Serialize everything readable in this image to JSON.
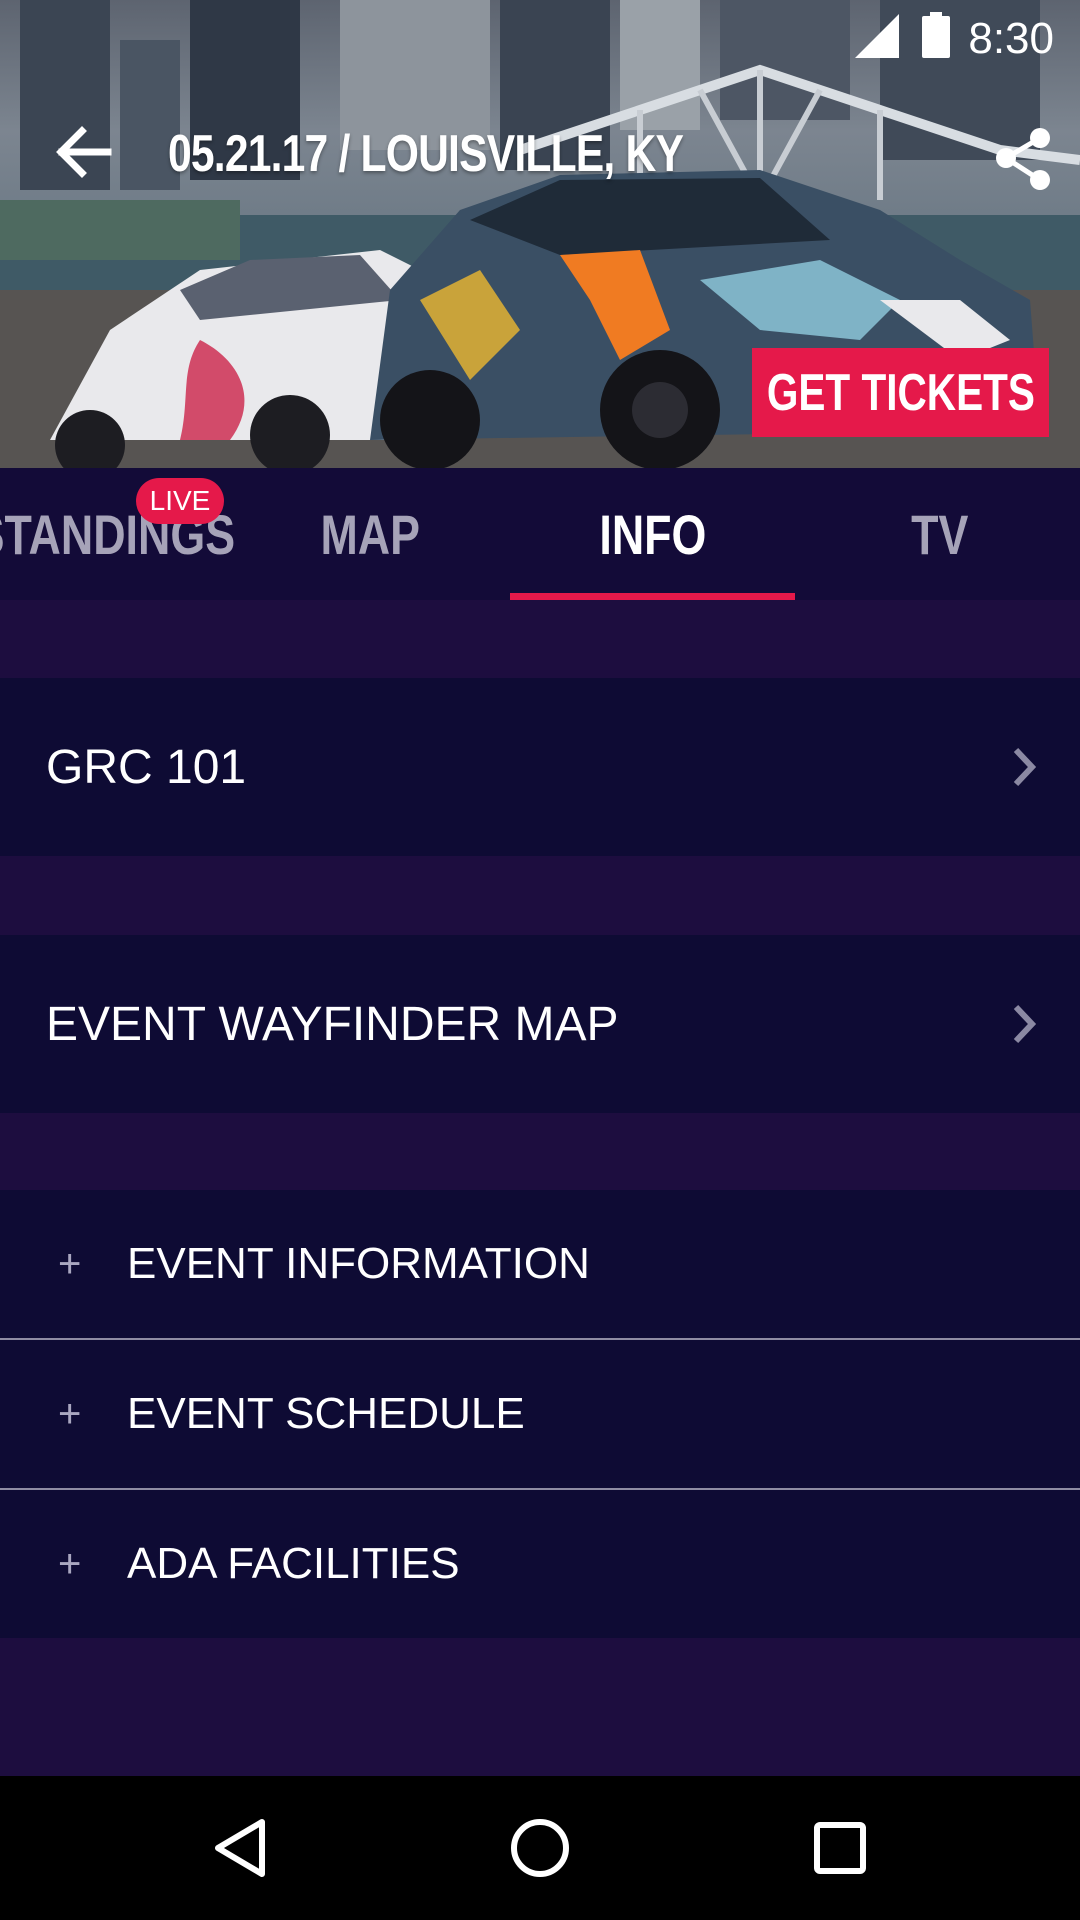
{
  "status_bar": {
    "time": "8:30"
  },
  "header": {
    "title": "05.21.17 / LOUISVILLE, KY",
    "tickets_label": "GET TICKETS"
  },
  "tabs": [
    {
      "label": "STANDINGS",
      "badge": "LIVE",
      "active": false
    },
    {
      "label": "MAP",
      "active": false
    },
    {
      "label": "INFO",
      "active": true
    },
    {
      "label": "TV",
      "active": false
    }
  ],
  "links": [
    {
      "label": "GRC 101"
    },
    {
      "label": "EVENT WAYFINDER MAP"
    }
  ],
  "accordion": [
    {
      "label": "EVENT INFORMATION"
    },
    {
      "label": "EVENT SCHEDULE"
    },
    {
      "label": "ADA FACILITIES"
    }
  ],
  "colors": {
    "accent": "#e5194a",
    "tab_bar": "#130b38",
    "row_bg": "#0e0b34",
    "page_bg": "#1d0d3f"
  },
  "icons": {
    "back": "arrow-left-icon",
    "share": "share-icon",
    "row_chevron": "chevron-right-icon",
    "accordion_expand": "plus-icon",
    "nav_back": "triangle-back-icon",
    "nav_home": "circle-home-icon",
    "nav_recents": "square-recents-icon"
  }
}
